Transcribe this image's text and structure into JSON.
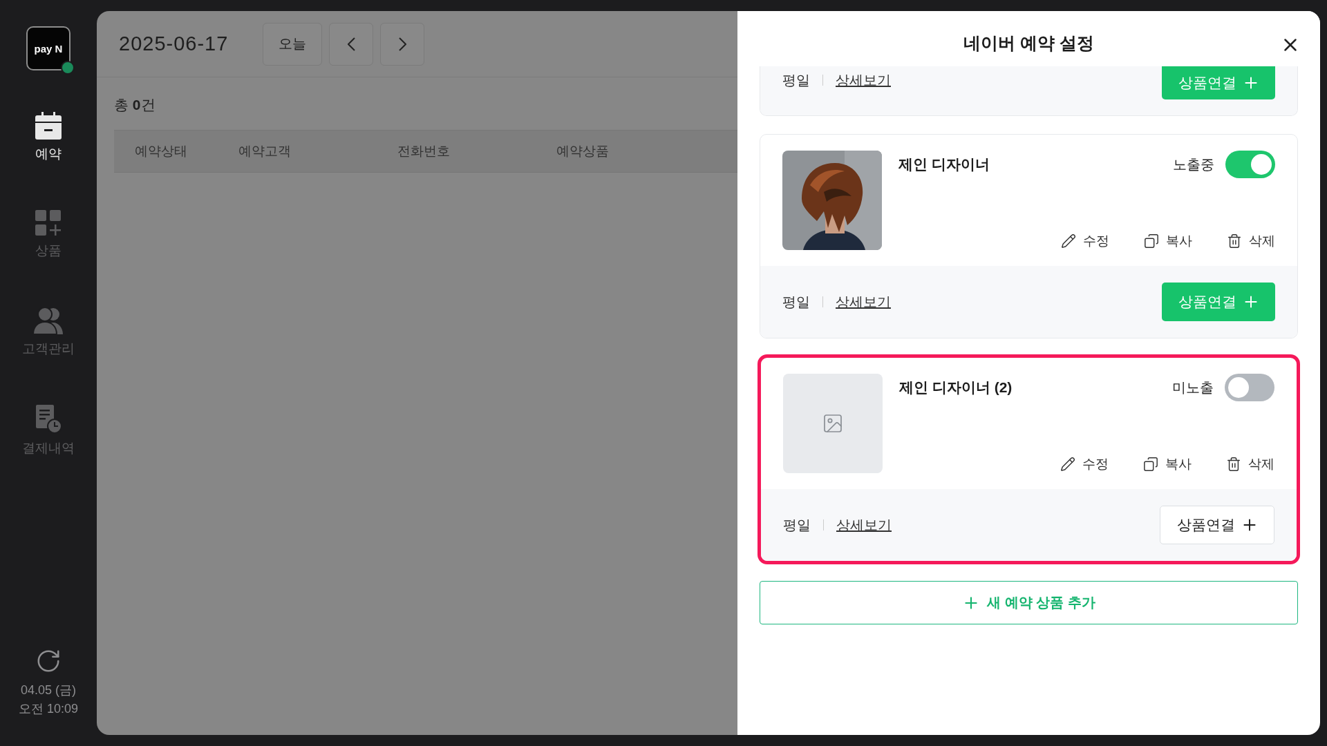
{
  "sidebar": {
    "logo": "pay N",
    "online": true,
    "items": [
      {
        "label": "예약",
        "selected": true
      },
      {
        "label": "상품",
        "selected": false
      },
      {
        "label": "고객관리",
        "selected": false
      },
      {
        "label": "결제내역",
        "selected": false
      }
    ],
    "clock": {
      "date": "04.05 (금)",
      "time": "오전 10:09"
    }
  },
  "main": {
    "date": "2025-06-17",
    "today_button": "오늘",
    "total": "총 **0**건",
    "table": {
      "columns": [
        "예약상태",
        "예약고객",
        "전화번호",
        "예약상품"
      ]
    }
  },
  "panel": {
    "title": "네이버 예약 설정",
    "cards": [
      {
        "kind": "footer",
        "day": "평일",
        "detail_link": "상세보기",
        "connect_button": "상품연결",
        "filled": true
      },
      {
        "kind": "full",
        "has_photo": true,
        "name": "제인 디자이너",
        "visibility_label": "노출중",
        "on": true,
        "actions": [
          "수정",
          "복사",
          "삭제"
        ],
        "day": "평일",
        "detail_link": "상세보기",
        "connect_button": "상품연결",
        "filled": true,
        "highlighted": false
      },
      {
        "kind": "full",
        "has_photo": false,
        "name": "제인 디자이너 (2)",
        "visibility_label": "미노출",
        "on": false,
        "actions": [
          "수정",
          "복사",
          "삭제"
        ],
        "day": "평일",
        "detail_link": "상세보기",
        "connect_button": "상품연결",
        "filled": false,
        "highlighted": true
      }
    ],
    "add_button": "새 예약 상품 추가"
  }
}
